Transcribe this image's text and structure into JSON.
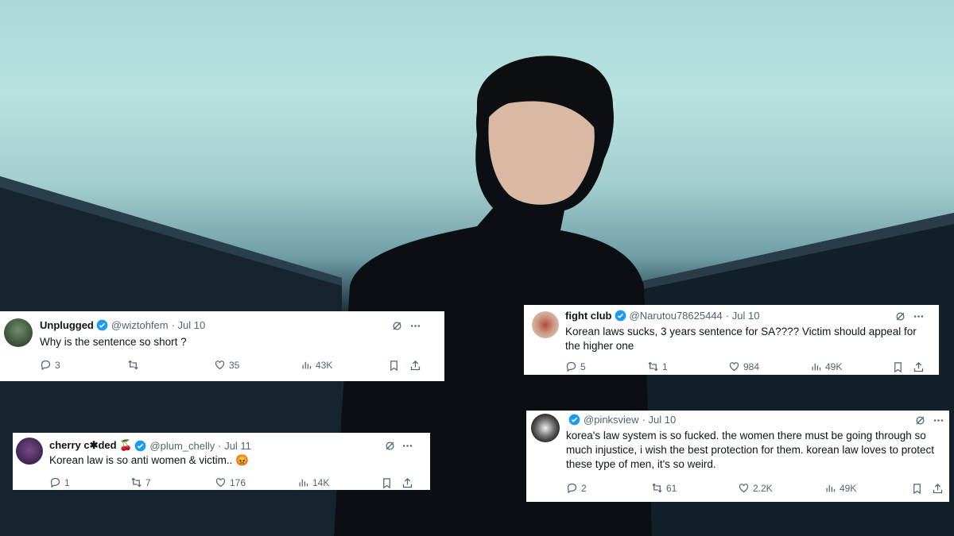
{
  "colors": {
    "verified": "#1d9bf0",
    "text": "#0f1419",
    "muted": "#536471"
  },
  "tweets": [
    {
      "name": "Unplugged",
      "handle": "@wiztohfem",
      "date": "· Jul 10",
      "text": "Why is the sentence so short ?",
      "replies": "3",
      "retweets": "",
      "likes": "35",
      "views": "43K"
    },
    {
      "name": "fight club",
      "handle": "@Narutou78625444",
      "date": "· Jul 10",
      "text": "Korean laws sucks, 3 years sentence for SA???? Victim should appeal for the higher one",
      "replies": "5",
      "retweets": "1",
      "likes": "984",
      "views": "49K"
    },
    {
      "name": "cherry c✱ded 🍒",
      "handle": "@plum_chelly",
      "date": "· Jul 11",
      "text": "Korean law is so anti women & victim.. 😡",
      "replies": "1",
      "retweets": "7",
      "likes": "176",
      "views": "14K"
    },
    {
      "name": "",
      "handle": "@pinksview",
      "date": "· Jul 10",
      "text": "korea's law system is so fucked. the women there must be going through so much injustice, i wish the best protection for them. korean law loves to protect these type of men, it's so weird.",
      "replies": "2",
      "retweets": "61",
      "likes": "2.2K",
      "views": "49K"
    }
  ]
}
